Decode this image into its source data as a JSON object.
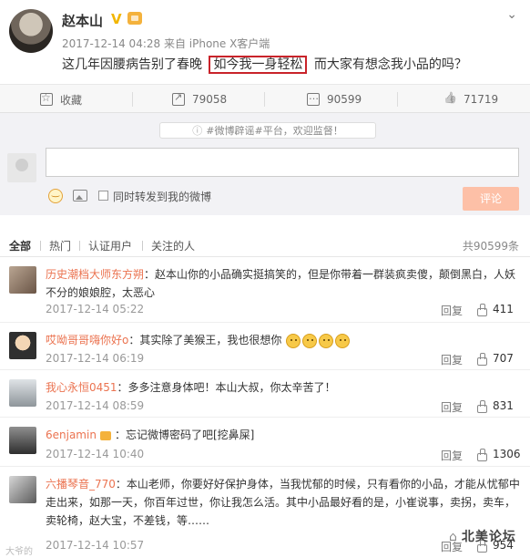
{
  "post": {
    "author": "赵本山",
    "verified_badge": "V",
    "timestamp_source": "2017-12-14 04:28 来自 iPhone X客户端",
    "text_before": "这几年因腰病告别了春晚",
    "text_highlight": "如今我一身轻松",
    "text_after": "而大家有想念我小品的吗？"
  },
  "actions": {
    "favorite_label": "收藏",
    "forward_count": "79058",
    "comment_count": "90599",
    "like_count": "71719"
  },
  "composer": {
    "notice_text": "#微博辟谣#平台，欢迎监督！",
    "input_value": "",
    "forward_checkbox_label": "同时转发到我的微博",
    "submit_label": "评论"
  },
  "tabs": {
    "items": [
      "全部",
      "热门",
      "认证用户",
      "关注的人"
    ],
    "total": "共90599条"
  },
  "comments": [
    {
      "name": "历史潮档大师东方朔",
      "text": "：赵本山你的小品确实挺搞笑的，但是你带着一群装疯卖傻，颠倒黑白，人妖不分的娘娘腔，太恶心",
      "time": "2017-12-14 05:22",
      "reply": "回复",
      "likes": "411"
    },
    {
      "name": "哎呦哥哥嗨你好o",
      "text": "：其实除了美猴王，我也很想你",
      "time": "2017-12-14 06:19",
      "reply": "回复",
      "likes": "707"
    },
    {
      "name": "我心永恒0451",
      "text": "：多多注意身体吧！本山大叔，你太辛苦了！",
      "time": "2017-12-14 08:59",
      "reply": "回复",
      "likes": "831"
    },
    {
      "name": "6enjamin",
      "text": "：忘记微博密码了吧[挖鼻屎]",
      "time": "2017-12-14 10:40",
      "reply": "回复",
      "likes": "1306"
    },
    {
      "name": "六播琴音_770",
      "text": "：本山老师，你要好好保护身体，当我忧郁的时候，只有看你的小品，才能从忧郁中走出来，如那一天，你百年过世，你让我怎么活。其中小品最好看的是，小崔说事，卖拐，卖车，卖轮椅，赵大宝，不差钱，等……",
      "time": "2017-12-14 10:57",
      "reply": "回复",
      "likes": "954"
    }
  ],
  "watermark": {
    "main": "北美论坛",
    "left": "大爷的"
  },
  "colors": {
    "highlight_border": "#c9232a",
    "commenter_name": "#eb7350",
    "submit_bg": "#fdc0a7"
  }
}
